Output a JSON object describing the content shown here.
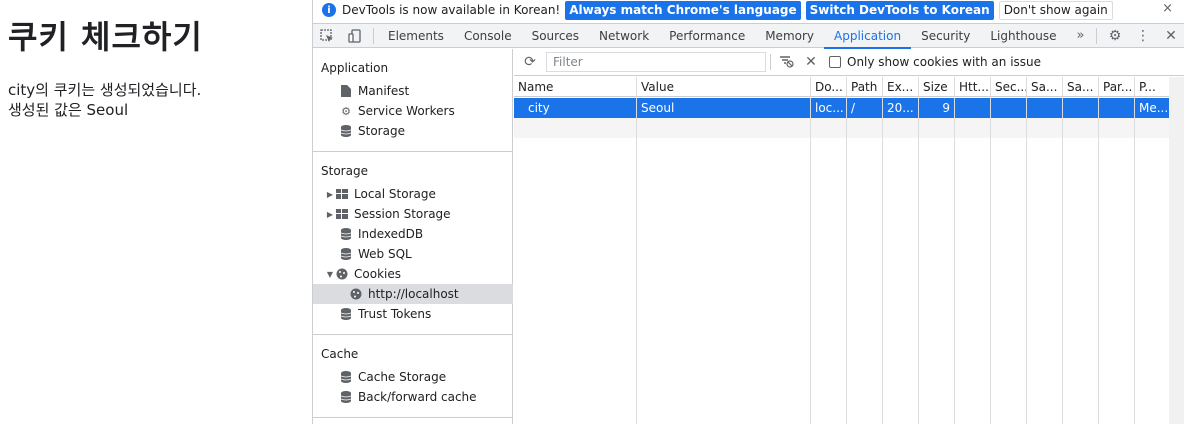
{
  "page": {
    "title": "쿠키 체크하기",
    "line1": "city의 쿠키는 생성되었습니다.",
    "line2": "생성된 값은 Seoul"
  },
  "infobar": {
    "message": "DevTools is now available in Korean!",
    "btn_match": "Always match Chrome's language",
    "btn_switch": "Switch DevTools to Korean",
    "btn_dismiss": "Don't show again",
    "close": "×"
  },
  "tabs": [
    "Elements",
    "Console",
    "Sources",
    "Network",
    "Performance",
    "Memory",
    "Application",
    "Security",
    "Lighthouse"
  ],
  "active_tab": "Application",
  "sidebar": {
    "application": {
      "title": "Application",
      "items": [
        "Manifest",
        "Service Workers",
        "Storage"
      ]
    },
    "storage": {
      "title": "Storage",
      "items": [
        "Local Storage",
        "Session Storage",
        "IndexedDB",
        "Web SQL",
        "Cookies",
        "http://localhost",
        "Trust Tokens"
      ]
    },
    "cache": {
      "title": "Cache",
      "items": [
        "Cache Storage",
        "Back/forward cache"
      ]
    }
  },
  "toolbar": {
    "filter_placeholder": "Filter",
    "only_issues_label": "Only show cookies with an issue"
  },
  "table": {
    "headers": [
      "Name",
      "Value",
      "Do...",
      "Path",
      "Ex...",
      "Size",
      "Htt...",
      "Sec...",
      "Sa...",
      "Sa...",
      "Par...",
      "P..."
    ],
    "row": [
      "city",
      "Seoul",
      "loc...",
      "/",
      "20...",
      "9",
      "",
      "",
      "",
      "",
      "",
      "Me..."
    ]
  },
  "colors": {
    "accent": "#1a73e8",
    "selected_sidebar": "#dadce0"
  }
}
